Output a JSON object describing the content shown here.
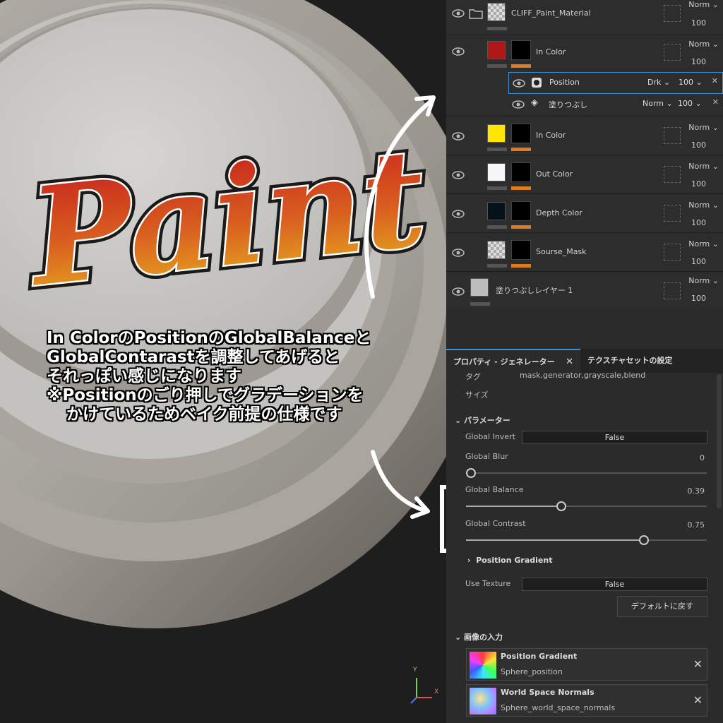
{
  "caption": {
    "line1": "In ColorのPositionのGlobalBalanceと",
    "line2": "GlobalContarastを調整してあげると",
    "line3": "それっぽい感じになります",
    "line4": "※Positionのごり押しでグラデーションを",
    "line5": "かけているためベイク前提の仕様です"
  },
  "viewport": {
    "logo_text": "Paint",
    "axis_y": "Y",
    "axis_x": "X"
  },
  "layers": [
    {
      "name": "CLIFF_Paint_Material",
      "blend": "Norm",
      "opacity": "100"
    },
    {
      "name": "In Color",
      "blend": "Norm",
      "opacity": "100"
    },
    {
      "name": "In Color",
      "blend": "Norm",
      "opacity": "100"
    },
    {
      "name": "Out Color",
      "blend": "Norm",
      "opacity": "100"
    },
    {
      "name": "Depth Color",
      "blend": "Norm",
      "opacity": "100"
    },
    {
      "name": "Sourse_Mask",
      "blend": "Norm",
      "opacity": "100"
    },
    {
      "name": "塗りつぶしレイヤー 1",
      "blend": "Norm",
      "opacity": "100"
    }
  ],
  "effects": [
    {
      "name": "Position",
      "blend": "Drk",
      "opacity": "100"
    },
    {
      "name": "塗りつぶし",
      "blend": "Norm",
      "opacity": "100"
    }
  ],
  "props": {
    "tab1": "プロパティ - ジェネレーター",
    "tab2": "テクスチャセットの設定",
    "tag_label": "タグ",
    "tag_value": "mask,generator,grayscale,blend",
    "size_label": "サイズ",
    "params_header": "パラメーター",
    "global_invert_label": "Global Invert",
    "global_invert_value": "False",
    "global_blur_label": "Global Blur",
    "global_blur_value": "0",
    "global_balance_label": "Global Balance",
    "global_balance_value": "0.39",
    "global_contrast_label": "Global Contrast",
    "global_contrast_value": "0.75",
    "position_gradient_header": "Position Gradient",
    "use_texture_label": "Use Texture",
    "use_texture_value": "False",
    "reset_button": "デフォルトに戻す",
    "image_inputs_header": "画像の入力",
    "inputs": [
      {
        "title": "Position Gradient",
        "source": "Sphere_position"
      },
      {
        "title": "World Space Normals",
        "source": "Sphere_world_space_normals"
      }
    ]
  },
  "slider_levels": {
    "global_blur": 0.0,
    "global_balance": 0.39,
    "global_contrast": 0.75
  },
  "colors": {
    "accent": "#3d8fd8",
    "orange": "#e07a1f",
    "in_color_red": "#b01818",
    "in_color_yellow": "#ffe600"
  }
}
